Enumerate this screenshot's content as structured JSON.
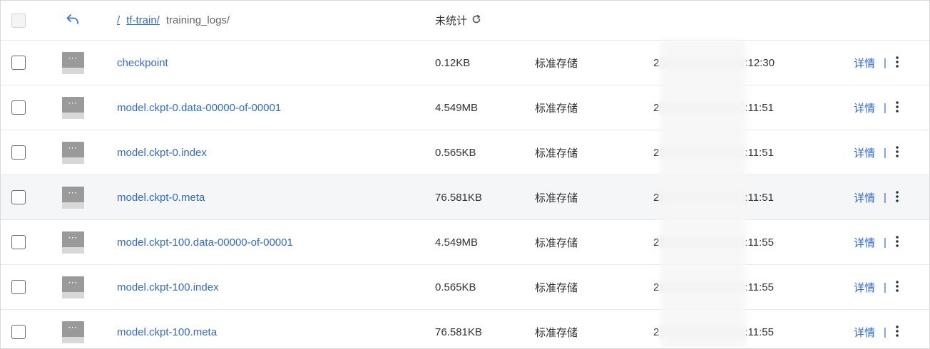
{
  "header": {
    "breadcrumb": {
      "root": "/",
      "bucket": "tf-train/",
      "current": "training_logs/"
    },
    "size_label": "未统计"
  },
  "rows": [
    {
      "name": "checkpoint",
      "size": "0.12KB",
      "storage": "标准存储",
      "time_lead": "2",
      "time_tail": ":12:30",
      "detail": "详情"
    },
    {
      "name": "model.ckpt-0.data-00000-of-00001",
      "size": "4.549MB",
      "storage": "标准存储",
      "time_lead": "2",
      "time_tail": ":11:51",
      "detail": "详情"
    },
    {
      "name": "model.ckpt-0.index",
      "size": "0.565KB",
      "storage": "标准存储",
      "time_lead": "2",
      "time_tail": ":11:51",
      "detail": "详情"
    },
    {
      "name": "model.ckpt-0.meta",
      "size": "76.581KB",
      "storage": "标准存储",
      "time_lead": "2",
      "time_tail": ":11:51",
      "detail": "详情"
    },
    {
      "name": "model.ckpt-100.data-00000-of-00001",
      "size": "4.549MB",
      "storage": "标准存储",
      "time_lead": "2",
      "time_tail": ":11:55",
      "detail": "详情"
    },
    {
      "name": "model.ckpt-100.index",
      "size": "0.565KB",
      "storage": "标准存储",
      "time_lead": "2",
      "time_tail": ":11:55",
      "detail": "详情"
    },
    {
      "name": "model.ckpt-100.meta",
      "size": "76.581KB",
      "storage": "标准存储",
      "time_lead": "2",
      "time_tail": ":11:55",
      "detail": "详情"
    }
  ],
  "icons": {
    "back": "back-arrow-icon",
    "refresh": "refresh-icon",
    "file": "file-icon",
    "more": "more-vertical-icon"
  },
  "colors": {
    "link": "#2d6ad6",
    "hover_row": "#f5f6f8",
    "border": "#e8e8e8"
  }
}
